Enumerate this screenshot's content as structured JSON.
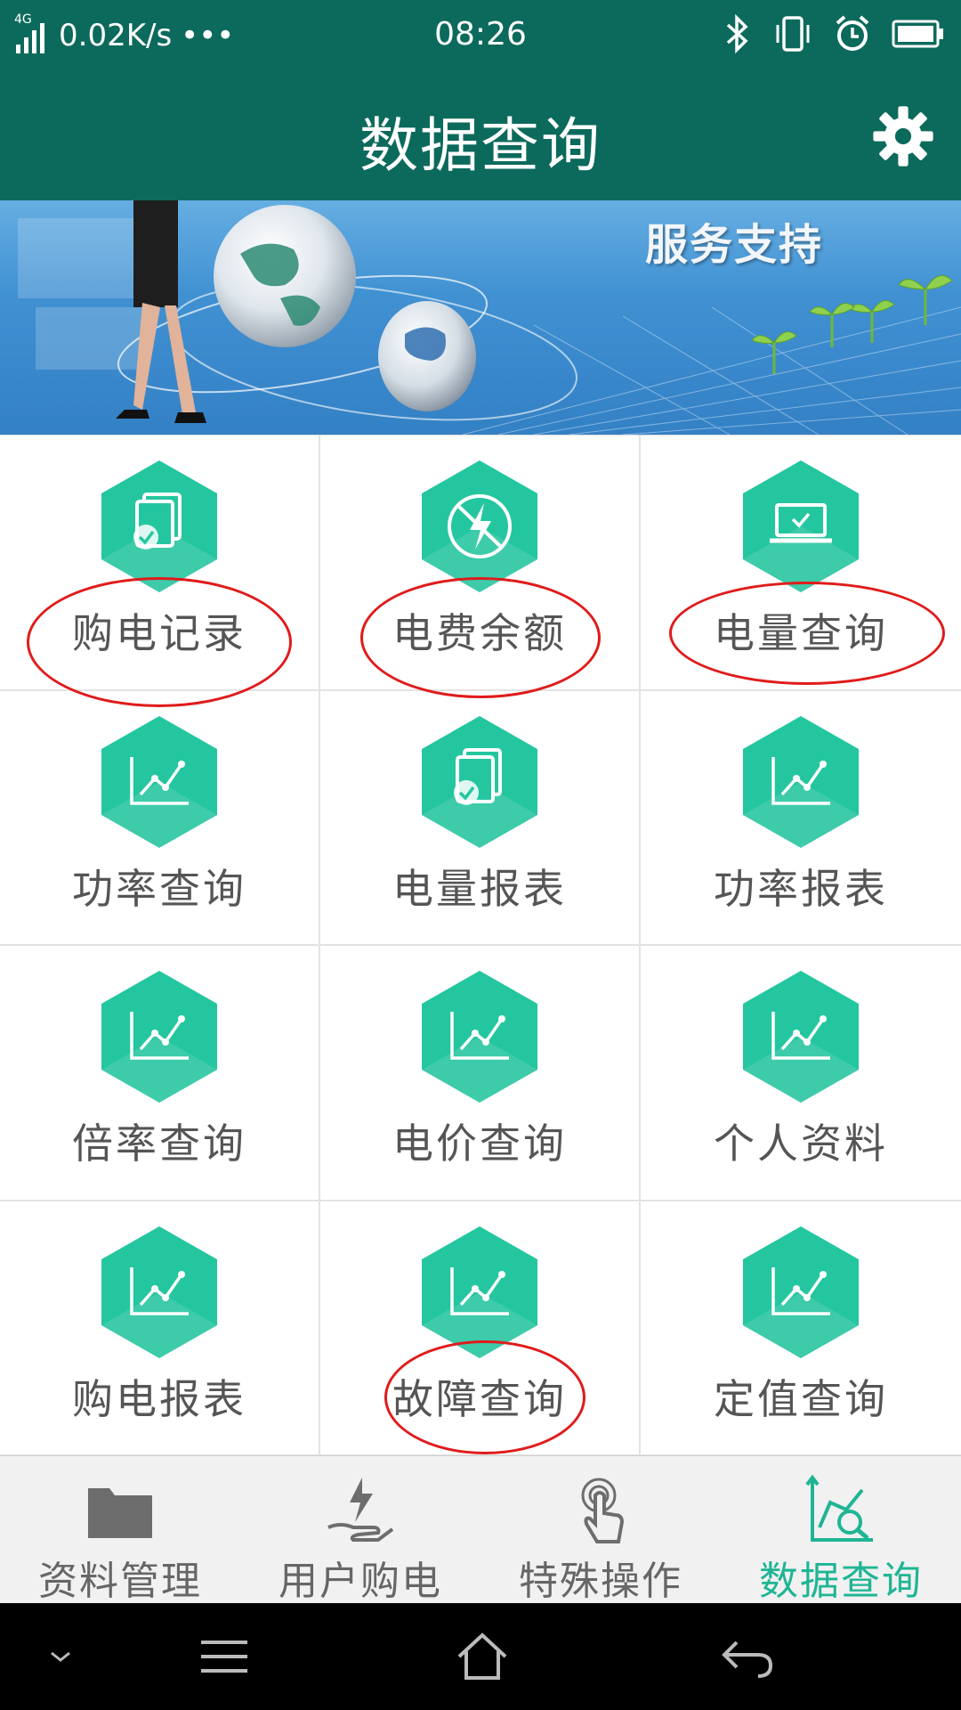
{
  "status_bar": {
    "network": "4G",
    "speed": "0.02K/s",
    "more": "•••",
    "time": "08:26",
    "icons": [
      "bluetooth-icon",
      "vibrate-icon",
      "alarm-icon",
      "battery-icon"
    ]
  },
  "header": {
    "title": "数据查询",
    "settings_icon": "gear-icon"
  },
  "banner": {
    "text": "服务支持"
  },
  "grid": {
    "items": [
      {
        "label": "购电记录",
        "icon": "document-check-icon"
      },
      {
        "label": "电费余额",
        "icon": "lightning-icon"
      },
      {
        "label": "电量查询",
        "icon": "laptop-check-icon"
      },
      {
        "label": "功率查询",
        "icon": "line-chart-icon"
      },
      {
        "label": "电量报表",
        "icon": "document-check-icon"
      },
      {
        "label": "功率报表",
        "icon": "line-chart-icon"
      },
      {
        "label": "倍率查询",
        "icon": "line-chart-icon"
      },
      {
        "label": "电价查询",
        "icon": "line-chart-icon"
      },
      {
        "label": "个人资料",
        "icon": "line-chart-icon"
      },
      {
        "label": "购电报表",
        "icon": "line-chart-icon"
      },
      {
        "label": "故障查询",
        "icon": "line-chart-icon"
      },
      {
        "label": "定值查询",
        "icon": "line-chart-icon"
      }
    ]
  },
  "bottom_nav": {
    "items": [
      {
        "label": "资料管理",
        "icon": "folder-icon",
        "active": false
      },
      {
        "label": "用户购电",
        "icon": "hand-power-icon",
        "active": false
      },
      {
        "label": "特殊操作",
        "icon": "touch-icon",
        "active": false
      },
      {
        "label": "数据查询",
        "icon": "chart-search-icon",
        "active": true
      }
    ]
  },
  "colors": {
    "header": "#0c6a5c",
    "hex_light": "#24c6a0",
    "hex_dark": "#17a886",
    "active_tab": "#1fb594",
    "annotation": "#e01b1b"
  }
}
